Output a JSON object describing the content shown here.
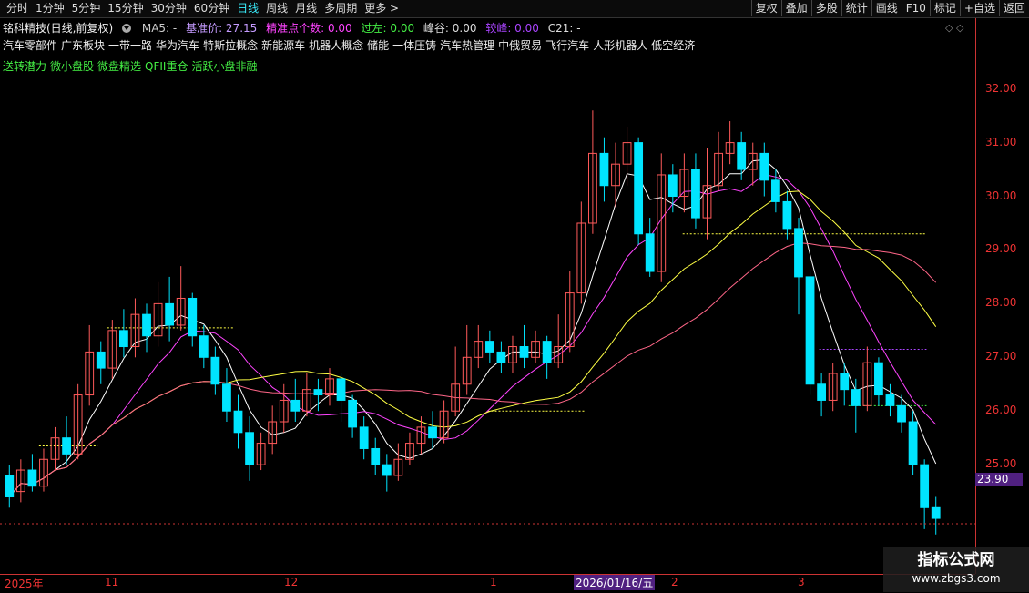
{
  "toolbar": {
    "periods": [
      "分时",
      "1分钟",
      "5分钟",
      "15分钟",
      "30分钟",
      "60分钟",
      "日线",
      "周线",
      "月线",
      "多周期",
      "更多 >"
    ],
    "active_period": "日线",
    "right_tools": [
      "复权",
      "叠加",
      "多股",
      "统计",
      "画线",
      "F10",
      "标记",
      "+自选",
      "返回"
    ]
  },
  "header": {
    "stock_name": "铭科精技(日线,前复权)",
    "ma5": "MA5: -",
    "base_price": "基准价: 27.15",
    "precise_points": "精准点个数: 0.00",
    "pass_left": "过左: 0.00",
    "peak_valley": "峰谷: 0.00",
    "compare": "较峰: 0.00",
    "c21": "C21: -"
  },
  "concepts": [
    "汽车零部件",
    "广东板块",
    "一带一路",
    "华为汽车",
    "特斯拉概念",
    "新能源车",
    "机器人概念",
    "储能",
    "一体压铸",
    "汽车热管理",
    "中俄贸易",
    "飞行汽车",
    "人形机器人",
    "低空经济"
  ],
  "tags": [
    "送转潜力",
    "微小盘股",
    "微盘精选",
    "QFII重仓",
    "活跃小盘非融"
  ],
  "price_axis": [
    "32.00",
    "31.00",
    "30.00",
    "29.00",
    "28.00",
    "27.00",
    "26.00",
    "25.00"
  ],
  "last_price": "23.90",
  "date_axis": {
    "labels": [
      "2025年",
      "11",
      "12",
      "1",
      "2",
      "3"
    ],
    "highlight": "2026/01/16/五"
  },
  "colors": {
    "up": "#ff5a5a",
    "down": "#00e5ff",
    "ma_white": "#ffffff",
    "ma_yellow": "#ffff44",
    "ma_magenta": "#ff44ff",
    "ma_pink": "#ff6688",
    "axis": "#c33"
  },
  "watermark": {
    "title": "指标公式网",
    "url": "www.zbgs3.com"
  },
  "chart_data": {
    "type": "candlestick",
    "y_range": [
      23.0,
      32.3
    ],
    "candles": [
      [
        24.8,
        24.4,
        25.0,
        24.2
      ],
      [
        24.5,
        24.9,
        25.1,
        24.3
      ],
      [
        24.9,
        24.6,
        25.2,
        24.5
      ],
      [
        24.6,
        25.1,
        25.3,
        24.5
      ],
      [
        25.1,
        25.5,
        25.7,
        24.9
      ],
      [
        25.5,
        25.2,
        25.9,
        25.0
      ],
      [
        25.2,
        26.3,
        26.5,
        25.1
      ],
      [
        26.3,
        27.1,
        27.6,
        26.1
      ],
      [
        27.1,
        26.8,
        27.3,
        26.5
      ],
      [
        26.8,
        27.5,
        27.7,
        26.6
      ],
      [
        27.5,
        27.2,
        27.9,
        27.0
      ],
      [
        27.2,
        27.8,
        28.1,
        27.0
      ],
      [
        27.8,
        27.4,
        28.0,
        27.1
      ],
      [
        27.4,
        28.0,
        28.4,
        27.2
      ],
      [
        28.0,
        27.6,
        28.5,
        27.3
      ],
      [
        27.6,
        28.1,
        28.7,
        27.5
      ],
      [
        28.1,
        27.4,
        28.2,
        27.2
      ],
      [
        27.4,
        27.0,
        27.6,
        26.8
      ],
      [
        27.0,
        26.5,
        27.2,
        26.3
      ],
      [
        26.5,
        26.0,
        26.8,
        25.8
      ],
      [
        26.0,
        25.6,
        26.3,
        25.3
      ],
      [
        25.6,
        25.0,
        25.9,
        24.7
      ],
      [
        25.0,
        25.4,
        25.6,
        24.9
      ],
      [
        25.4,
        25.8,
        26.1,
        25.2
      ],
      [
        25.8,
        26.2,
        26.5,
        25.6
      ],
      [
        26.2,
        26.0,
        26.6,
        25.8
      ],
      [
        26.0,
        26.4,
        26.7,
        25.9
      ],
      [
        26.4,
        26.3,
        26.6,
        26.0
      ],
      [
        26.3,
        26.6,
        26.8,
        26.1
      ],
      [
        26.6,
        26.2,
        26.7,
        25.8
      ],
      [
        26.2,
        25.7,
        26.3,
        25.5
      ],
      [
        25.7,
        25.3,
        25.9,
        25.1
      ],
      [
        25.3,
        25.0,
        25.5,
        24.8
      ],
      [
        25.0,
        24.8,
        25.2,
        24.5
      ],
      [
        24.8,
        25.1,
        25.4,
        24.7
      ],
      [
        25.1,
        25.4,
        25.6,
        25.0
      ],
      [
        25.4,
        25.7,
        25.9,
        25.2
      ],
      [
        25.7,
        25.5,
        26.0,
        25.3
      ],
      [
        25.5,
        26.0,
        26.2,
        25.4
      ],
      [
        26.0,
        26.5,
        27.2,
        25.9
      ],
      [
        26.5,
        27.0,
        27.6,
        26.3
      ],
      [
        27.0,
        27.3,
        27.6,
        26.8
      ],
      [
        27.3,
        27.1,
        27.5,
        26.9
      ],
      [
        27.1,
        26.9,
        27.3,
        26.7
      ],
      [
        26.9,
        27.2,
        27.4,
        26.7
      ],
      [
        27.2,
        27.0,
        27.6,
        26.8
      ],
      [
        27.0,
        27.3,
        27.5,
        26.9
      ],
      [
        27.3,
        26.9,
        27.4,
        26.6
      ],
      [
        26.9,
        27.2,
        27.8,
        26.8
      ],
      [
        27.2,
        28.2,
        28.6,
        27.1
      ],
      [
        28.2,
        29.5,
        29.9,
        28.0
      ],
      [
        29.5,
        30.8,
        31.6,
        29.3
      ],
      [
        30.8,
        30.2,
        31.1,
        29.9
      ],
      [
        30.2,
        30.6,
        31.0,
        29.8
      ],
      [
        30.6,
        31.0,
        31.3,
        30.2
      ],
      [
        31.0,
        29.3,
        31.1,
        29.1
      ],
      [
        29.3,
        28.6,
        29.6,
        28.5
      ],
      [
        28.6,
        30.4,
        30.8,
        28.4
      ],
      [
        30.4,
        30.0,
        30.6,
        29.7
      ],
      [
        30.0,
        30.5,
        30.8,
        29.7
      ],
      [
        30.5,
        29.6,
        30.8,
        29.4
      ],
      [
        29.6,
        30.2,
        30.9,
        29.2
      ],
      [
        30.2,
        30.8,
        31.2,
        30.1
      ],
      [
        30.8,
        31.0,
        31.4,
        30.6
      ],
      [
        31.0,
        30.5,
        31.2,
        30.3
      ],
      [
        30.5,
        30.8,
        31.0,
        30.2
      ],
      [
        30.8,
        30.3,
        31.0,
        30.0
      ],
      [
        30.3,
        29.9,
        30.5,
        29.7
      ],
      [
        29.9,
        29.4,
        30.1,
        29.2
      ],
      [
        29.4,
        28.5,
        29.6,
        27.8
      ],
      [
        28.5,
        26.5,
        28.6,
        26.3
      ],
      [
        26.5,
        26.2,
        26.7,
        25.9
      ],
      [
        26.2,
        26.7,
        26.9,
        26.0
      ],
      [
        26.7,
        26.4,
        26.9,
        26.1
      ],
      [
        26.4,
        26.1,
        26.6,
        25.6
      ],
      [
        26.1,
        26.9,
        27.2,
        26.0
      ],
      [
        26.9,
        26.3,
        27.0,
        26.1
      ],
      [
        26.3,
        26.1,
        26.5,
        25.9
      ],
      [
        26.1,
        25.8,
        26.3,
        25.6
      ],
      [
        25.8,
        25.0,
        26.0,
        24.8
      ],
      [
        25.0,
        24.2,
        25.1,
        23.8
      ],
      [
        24.2,
        24.0,
        24.4,
        23.7
      ]
    ],
    "levels": [
      {
        "price": 27.55,
        "x0": 0.11,
        "x1": 0.24,
        "color": "#ffff44"
      },
      {
        "price": 25.35,
        "x0": 0.04,
        "x1": 0.1,
        "color": "#ffff44"
      },
      {
        "price": 26.0,
        "x0": 0.5,
        "x1": 0.6,
        "color": "#ffff44"
      },
      {
        "price": 29.3,
        "x0": 0.7,
        "x1": 0.95,
        "color": "#ffff44"
      },
      {
        "price": 26.1,
        "x0": 0.87,
        "x1": 0.95,
        "color": "#44ee44"
      },
      {
        "price": 27.15,
        "x0": 0.84,
        "x1": 0.95,
        "color": "#aa44ff"
      }
    ]
  }
}
